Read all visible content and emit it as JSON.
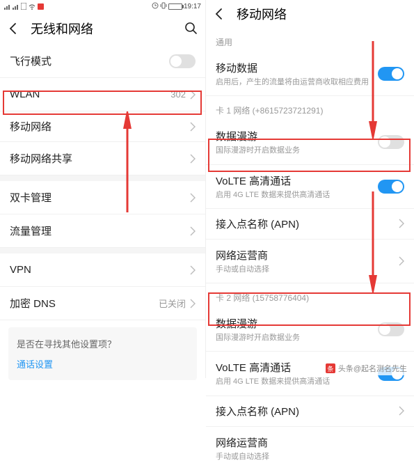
{
  "status": {
    "time": "19:17"
  },
  "left": {
    "title": "无线和网络",
    "airplane": "飞行模式",
    "wlan": "WLAN",
    "wlan_value": "302",
    "mobile_net": "移动网络",
    "tethering": "移动网络共享",
    "dual_sim": "双卡管理",
    "traffic": "流量管理",
    "vpn": "VPN",
    "dns": "加密 DNS",
    "dns_value": "已关闭",
    "card_title": "是否在寻找其他设置项？",
    "card_link": "通话设置"
  },
  "right": {
    "title": "移动网络",
    "section_general": "通用",
    "mobile_data": "移动数据",
    "mobile_data_sub": "启用后，产生的流量将由运营商收取相应费用",
    "sim1_header": "卡 1 网络 (+8615723721291)",
    "roaming": "数据漫游",
    "roaming_sub": "国际漫游时开启数据业务",
    "volte": "VoLTE 高清通话",
    "volte_sub": "启用 4G LTE 数据来提供高清通话",
    "apn": "接入点名称 (APN)",
    "carrier": "网络运营商",
    "carrier_sub": "手动或自动选择",
    "sim2_header": "卡 2 网络 (15758776404)",
    "roaming2": "数据漫游",
    "roaming2_sub": "国际漫游时开启数据业务",
    "volte2": "VoLTE 高清通话",
    "volte2_sub": "启用 4G LTE 数据来提供高清通话",
    "apn2": "接入点名称 (APN)",
    "carrier2": "网络运营商",
    "carrier2_sub": "手动或自动选择"
  },
  "watermark": "头条@起名测名先生"
}
